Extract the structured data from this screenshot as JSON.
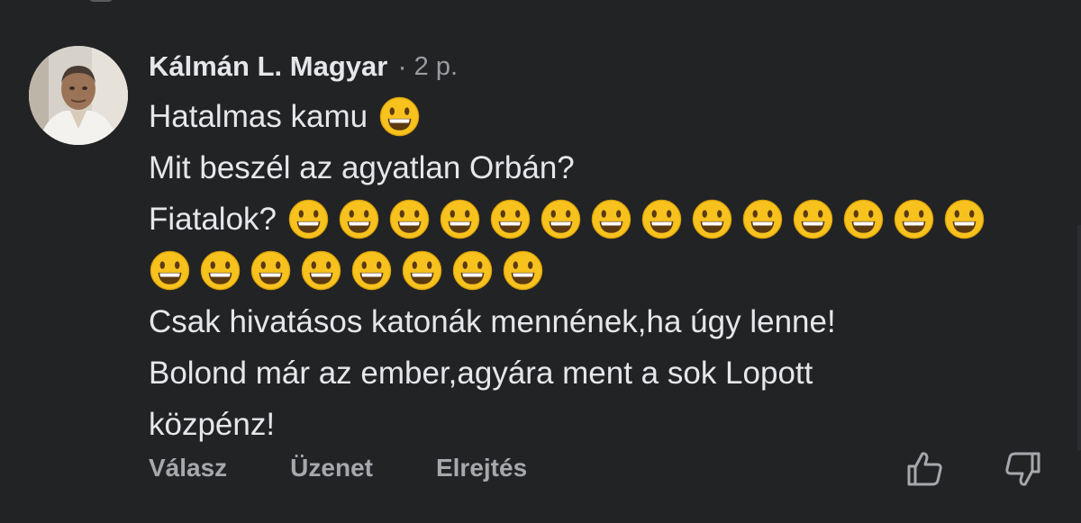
{
  "comment": {
    "author": "Kálmán L. Magyar",
    "separator": "·",
    "time": "2 p.",
    "lines": [
      {
        "text": "Hatalmas kamu",
        "emoji_after": 1
      },
      {
        "text": "Mit beszél az agyatlan Orbán?",
        "emoji_after": 0
      },
      {
        "text": "Fiatalok?",
        "emoji_after": 14
      },
      {
        "text": "",
        "emoji_after": 8
      },
      {
        "text": "Csak hivatásos katonák mennének,ha úgy lenne!",
        "emoji_after": 0
      },
      {
        "text": "Bolond már az ember,agyára ment a sok Lopott",
        "emoji_after": 0
      },
      {
        "text": "közpénz!",
        "emoji_after": 0
      }
    ],
    "emoji_icon": "grinning-face-icon"
  },
  "actions": {
    "reply_label": "Válasz",
    "message_label": "Üzenet",
    "hide_label": "Elrejtés",
    "upvote_icon": "thumbs-up-icon",
    "downvote_icon": "thumbs-down-icon"
  },
  "colors": {
    "background": "#222325",
    "text": "#e6e7ea",
    "muted": "#9a9ca1",
    "emoji_face": "#f7c21e"
  }
}
